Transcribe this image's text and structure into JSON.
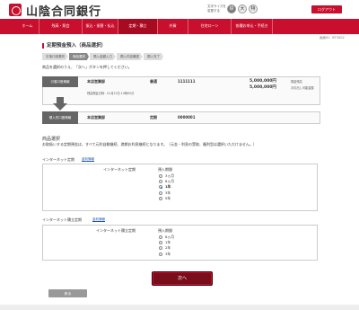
{
  "header": {
    "bank_name": "山陰合同銀行",
    "font_size_label": "文字サイズを変更する",
    "font_size_options": [
      "標",
      "大",
      "特"
    ],
    "logout": "ログアウト"
  },
  "nav": {
    "items": [
      "ホーム",
      "残高・照会",
      "振込・振替・払込",
      "定期・積立",
      "外貨",
      "住宅ローン",
      "各種お申込・手続き"
    ]
  },
  "screen_id": "画面ID：BT3002",
  "page_title": "定期預金預入（商品選択）",
  "steps": [
    "引落口座選択",
    "商品選択",
    "預入金額入力",
    "預入内容確認",
    "預入完了"
  ],
  "instruction": "商品を選択のうえ、「次へ」ボタンを押してください。",
  "debit": {
    "tag": "引落口座情報",
    "branch": "本店営業部",
    "type": "普通",
    "number": "1111111",
    "balance": "5,000,000円",
    "balance_label": "預金残高",
    "available": "5,000,000円",
    "available_label": "お引出し可能金額",
    "date_label": "残高照会日時：01月22日 10時00分"
  },
  "deposit": {
    "tag": "預入先口座情報",
    "branch": "本店営業部",
    "type": "定期",
    "number": "0000001"
  },
  "product_section": {
    "title": "商品選択",
    "note": "お取扱いする定期預金は、すべて元利自動継続、満期お利息継続となります。（元金・利息の受取、複利型は選択いただけません。）"
  },
  "internet_teiki": {
    "title": "インターネット定期",
    "link": "金利情報",
    "row_label": "インターネット定期",
    "period_label": "預入期間",
    "options": [
      "3ヵ月",
      "6ヵ月",
      "1年",
      "3年",
      "5年"
    ],
    "selected": "1年"
  },
  "internet_tsumitate": {
    "title": "インターネット積立定期",
    "link": "金利情報",
    "row_label": "インターネット積立定期",
    "period_label": "預入期間",
    "options": [
      "6ヵ月",
      "1年",
      "2年",
      "3年"
    ]
  },
  "buttons": {
    "next": "次へ",
    "back": "戻る"
  }
}
